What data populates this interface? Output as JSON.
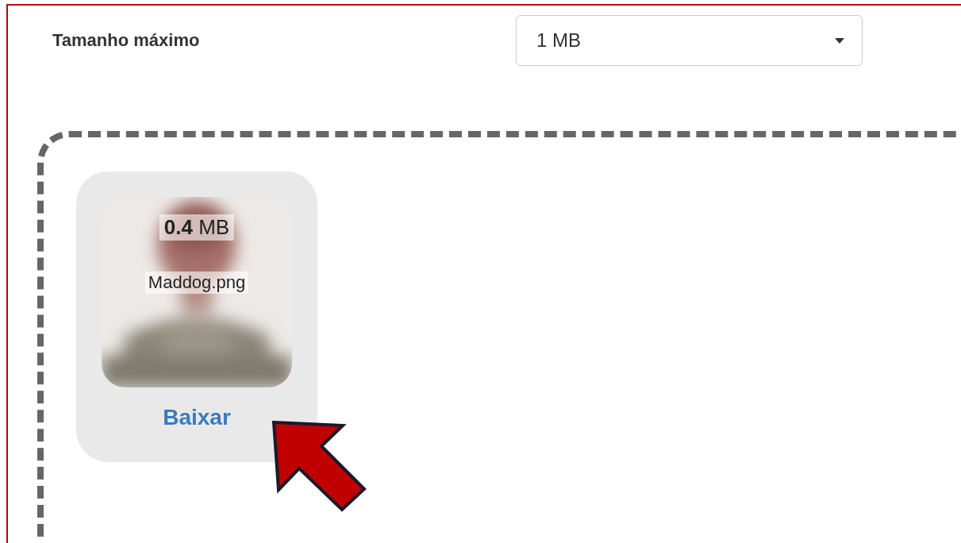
{
  "max_size": {
    "label": "Tamanho máximo",
    "value": "1 MB"
  },
  "files": [
    {
      "kind": "picture",
      "size": "**0.4** MB",
      "name": "Maddog.png",
      "download": "Baixar"
    }
  ]
}
